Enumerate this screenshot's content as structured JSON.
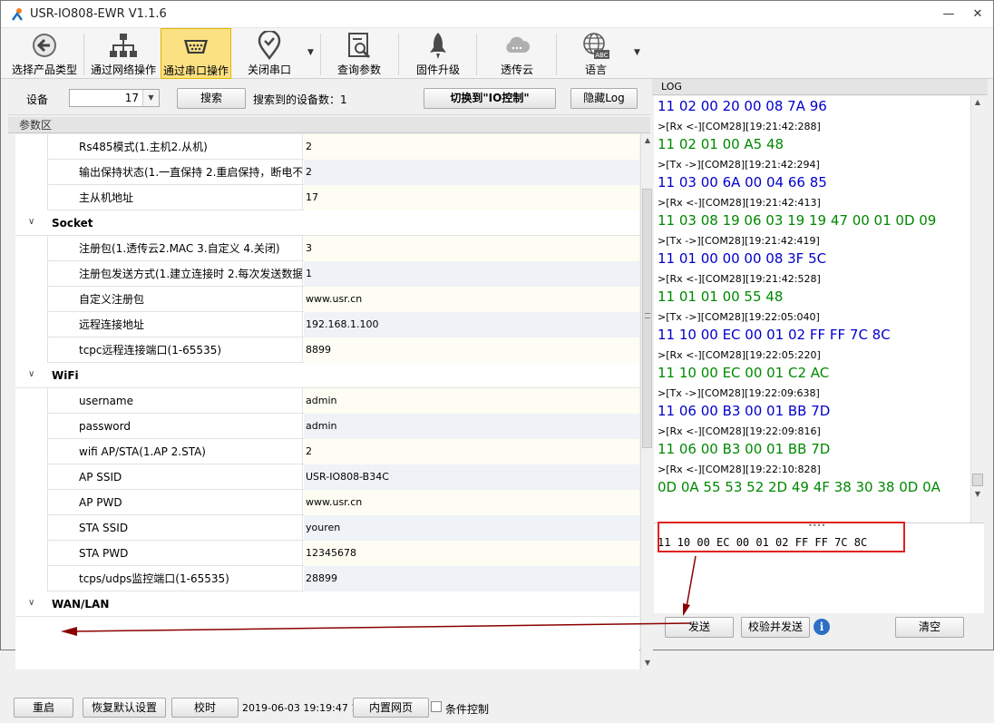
{
  "window": {
    "title": "USR-IO808-EWR V1.1.6",
    "controls": [
      "—",
      "□",
      "✕"
    ]
  },
  "toolbar": [
    {
      "label": "选择产品类型",
      "icon": "back-arrow-icon"
    },
    {
      "label": "通过网络操作",
      "icon": "network-icon"
    },
    {
      "label": "通过串口操作",
      "icon": "serial-port-icon",
      "active": true
    },
    {
      "label": "关闭串口",
      "icon": "location-pin-icon"
    },
    {
      "label": "查询参数",
      "icon": "query-doc-icon"
    },
    {
      "label": "固件升级",
      "icon": "rocket-icon"
    },
    {
      "label": "透传云",
      "icon": "cloud-icon"
    },
    {
      "label": "语言",
      "icon": "globe-abc-icon"
    }
  ],
  "device": {
    "label": "设备",
    "value": "17",
    "search_button": "搜索",
    "count_label": "搜索到的设备数：",
    "count": "1",
    "switch_button": "切换到\"IO控制\"",
    "hide_log_button": "隐藏Log"
  },
  "params": {
    "section_label": "参数区",
    "rows": [
      {
        "type": "row",
        "key": "Rs485模式(1.主机2.从机)",
        "value": "2",
        "shade": "a"
      },
      {
        "type": "row",
        "key": "输出保持状态(1.一直保持 2.重启保持，断电不",
        "value": "2",
        "shade": "b"
      },
      {
        "type": "row",
        "key": "主从机地址",
        "value": "17",
        "shade": "a"
      },
      {
        "type": "cat",
        "key": "Socket"
      },
      {
        "type": "row",
        "key": "注册包(1.透传云2.MAC 3.自定义 4.关闭)",
        "value": "3",
        "shade": "a"
      },
      {
        "type": "row",
        "key": "注册包发送方式(1.建立连接时 2.每次发送数据",
        "value": "1",
        "shade": "b"
      },
      {
        "type": "row",
        "key": "自定义注册包",
        "value": "www.usr.cn",
        "shade": "a"
      },
      {
        "type": "row",
        "key": "远程连接地址",
        "value": "192.168.1.100",
        "shade": "b"
      },
      {
        "type": "row",
        "key": "tcpc远程连接端口(1-65535)",
        "value": "8899",
        "shade": "a"
      },
      {
        "type": "cat",
        "key": "WiFi"
      },
      {
        "type": "row",
        "key": "username",
        "value": "admin",
        "shade": "a"
      },
      {
        "type": "row",
        "key": "password",
        "value": "admin",
        "shade": "b"
      },
      {
        "type": "row",
        "key": "wifi AP/STA(1.AP 2.STA)",
        "value": "2",
        "shade": "a"
      },
      {
        "type": "row",
        "key": "AP SSID",
        "value": "USR-IO808-B34C",
        "shade": "b"
      },
      {
        "type": "row",
        "key": "AP PWD",
        "value": "www.usr.cn",
        "shade": "a"
      },
      {
        "type": "row",
        "key": "STA SSID",
        "value": "youren",
        "shade": "b"
      },
      {
        "type": "row",
        "key": "STA PWD",
        "value": "12345678",
        "shade": "a"
      },
      {
        "type": "row",
        "key": "tcps/udps监控端口(1-65535)",
        "value": "28899",
        "shade": "b"
      },
      {
        "type": "cat",
        "key": "WAN/LAN"
      }
    ]
  },
  "bottom": {
    "restart": "重启",
    "restore": "恢复默认设置",
    "timing": "校时",
    "datetime": "2019-06-03 19:19:47 1",
    "webpage": "内置网页",
    "cond_label": "条件控制"
  },
  "log": {
    "header": "LOG",
    "entries": [
      {
        "t": "rx",
        "text": "11 02 00 20 00 08 7A 96",
        "c": "tx"
      },
      {
        "t": "meta",
        "text": ">[Rx <-][COM28][19:21:42:288]"
      },
      {
        "t": "data",
        "text": "11 02 01 00 A5 48",
        "c": "rx"
      },
      {
        "t": "meta",
        "text": ">[Tx ->][COM28][19:21:42:294]"
      },
      {
        "t": "data",
        "text": "11 03 00 6A 00 04 66 85",
        "c": "tx"
      },
      {
        "t": "meta",
        "text": ">[Rx <-][COM28][19:21:42:413]"
      },
      {
        "t": "data",
        "text": "11 03 08 19 06 03 19 19 47 00 01 0D 09",
        "c": "rx"
      },
      {
        "t": "meta",
        "text": ">[Tx ->][COM28][19:21:42:419]"
      },
      {
        "t": "data",
        "text": "11 01 00 00 00 08 3F 5C",
        "c": "tx"
      },
      {
        "t": "meta",
        "text": ">[Rx <-][COM28][19:21:42:528]"
      },
      {
        "t": "data",
        "text": "11 01 01 00 55 48",
        "c": "rx"
      },
      {
        "t": "meta",
        "text": ">[Tx ->][COM28][19:22:05:040]"
      },
      {
        "t": "data",
        "text": "11 10 00 EC 00 01 02 FF FF 7C 8C",
        "c": "tx"
      },
      {
        "t": "meta",
        "text": ">[Rx <-][COM28][19:22:05:220]"
      },
      {
        "t": "data",
        "text": "11 10 00 EC 00 01 C2 AC",
        "c": "rx"
      },
      {
        "t": "meta",
        "text": ">[Tx ->][COM28][19:22:09:638]"
      },
      {
        "t": "data",
        "text": "11 06 00 B3 00 01 BB 7D",
        "c": "tx"
      },
      {
        "t": "meta",
        "text": ">[Rx <-][COM28][19:22:09:816]"
      },
      {
        "t": "data",
        "text": "11 06 00 B3 00 01 BB 7D",
        "c": "rx"
      },
      {
        "t": "meta",
        "text": ">[Rx <-][COM28][19:22:10:828]"
      },
      {
        "t": "data",
        "text": "0D 0A 55 53 52 2D 49 4F 38 30 38 0D 0A",
        "c": "rx"
      }
    ],
    "send_text": "11 10 00 EC 00 01 02 FF FF 7C 8C",
    "send_button": "发送",
    "check_send_button": "校验并发送",
    "clear_button": "清空"
  },
  "colors": {
    "tx": "#0000cc",
    "rx": "#008800",
    "highlight": "#e02020",
    "arrow": "#8b0000",
    "active_tab": "#fce183"
  }
}
